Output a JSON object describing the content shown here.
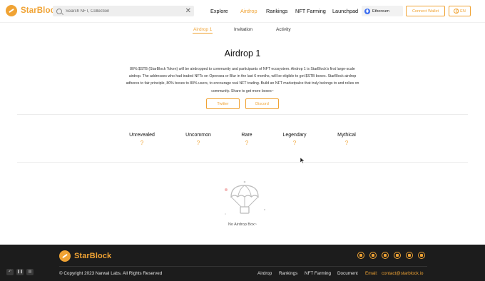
{
  "header": {
    "brand": "StarBlock",
    "search_placeholder": "Search NFT, Collection",
    "clear_symbol": "✕",
    "nav": [
      "Explore",
      "Airdrop",
      "Rankings",
      "NFT Farming",
      "Launchpad"
    ],
    "nav_active": "Airdrop",
    "chain": "Ethereum",
    "connect_label": "Connect Wallet",
    "lang_label": "EN"
  },
  "tabs": [
    "Airdrop 1",
    "Invitation",
    "Activity"
  ],
  "tab_active": "Airdrop 1",
  "main": {
    "title": "Airdrop 1",
    "description": "80% $STB (StarBlock Token) will be airdropped to community and participants of NFT ecosystem. Airdrop 1 is StarBlock's first large-scale airdrop. The addresses who had traded NFTs on Opensea or Blur in the last 6 months, will be eligible to get $STB boxes. StarBlock airdrop adheres to fair principle, 80% boxes to 80% users, to encourage real NFT trading. Build an NFT marketpalce that truly belongs to and relies on community. Share to get more boxes~",
    "twitter_label": "Twitter",
    "discord_label": "Discord",
    "rarities": [
      {
        "name": "Unrevealed",
        "value": "?"
      },
      {
        "name": "Uncommon",
        "value": "?"
      },
      {
        "name": "Rare",
        "value": "?"
      },
      {
        "name": "Legendary",
        "value": "?"
      },
      {
        "name": "Mythical",
        "value": "?"
      }
    ],
    "empty_text": "No Airdrop Box~"
  },
  "footer": {
    "brand": "StarBlock",
    "copyright": "© Copyright 2023 Narwal Labs. All Rights Reserved",
    "links": [
      "Airdrop",
      "Rankings",
      "NFT Farming",
      "Document"
    ],
    "email_label": "Email:",
    "email": "contact@starblock.io",
    "social_icons": [
      "twitter-icon",
      "telegram-icon",
      "discord-icon",
      "github-icon",
      "medium-icon",
      "mirror-icon"
    ]
  },
  "colors": {
    "accent": "#f0a334",
    "footer_bg": "#1c1c1c"
  }
}
